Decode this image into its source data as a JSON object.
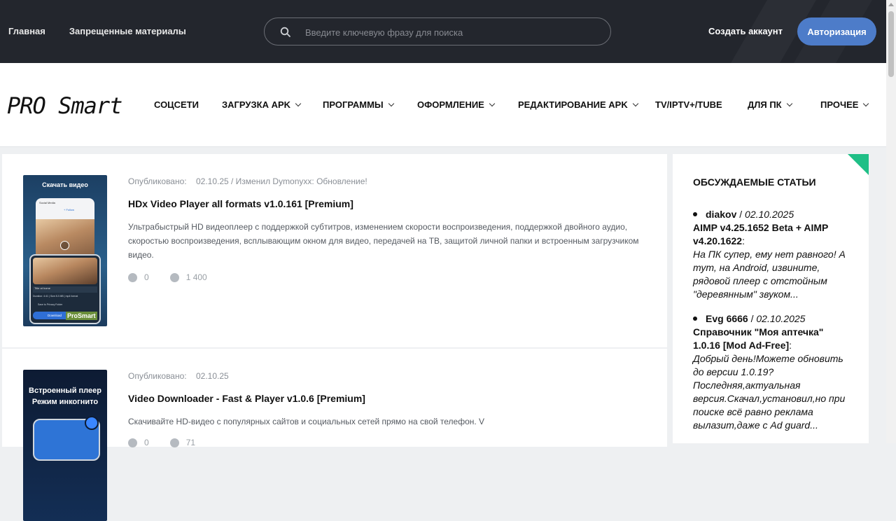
{
  "topbar": {
    "links": [
      "Главная",
      "Запрещенные материалы"
    ],
    "search_placeholder": "Введите ключевую фразу для поиска",
    "create_account": "Создать аккаунт",
    "login": "Авторизация",
    "colors": {
      "bg": "#23262d",
      "accent": "#4d7cc9"
    }
  },
  "header": {
    "logo": "PRO Smart",
    "nav": [
      {
        "label": "СОЦСЕТИ",
        "dropdown": false
      },
      {
        "label": "ЗАГРУЗКА APK",
        "dropdown": true
      },
      {
        "label": "ПРОГРАММЫ",
        "dropdown": true
      },
      {
        "label": "ОФОРМЛЕНИЕ",
        "dropdown": true
      },
      {
        "label": "РЕДАКТИРОВАНИЕ APK",
        "dropdown": true
      },
      {
        "label": "TV/IPTV+/TUBE",
        "dropdown": false
      },
      {
        "label": "ДЛЯ ПК",
        "dropdown": true
      },
      {
        "label": "ПРОЧЕЕ",
        "dropdown": true
      }
    ]
  },
  "posts": [
    {
      "meta_label": "Опубликовано:",
      "meta_value": "02.10.25 / Изменил Dymonyxx: Обновление!",
      "title": "HDx Video Player all formats v1.0.161 [Premium]",
      "description": "Ультрабыстрый HD видеоплеер с поддержкой субтитров, изменением скорости воспроизведения, поддержкой двойного аудио, скоростью воспроизведения, всплывающим окном для видео, передачей на ТВ, защитой личной папки и встроенным загрузчиком видео.",
      "comments": "0",
      "views": "1 400",
      "thumb": {
        "caption": "Скачать видео",
        "social": "Social Media",
        "follow": "+ Follow",
        "file": "Title at home",
        "info": "Duration: 4:41 | Size 8.3 MB | mp4 format",
        "save": "Save to Privacy Folder",
        "download": "Download",
        "watermark": "ProSmart"
      }
    },
    {
      "meta_label": "Опубликовано:",
      "meta_value": "02.10.25",
      "title": "Video Downloader - Fast & Player v1.0.6 [Premium]",
      "description": "Скачивайте HD-видео с популярных сайтов и социальных сетей прямо на свой телефон. V",
      "comments": "0",
      "views": "71",
      "thumb": {
        "caption_line1": "Встроенный плеер",
        "caption_line2": "Режим инкогнито"
      }
    }
  ],
  "sidebar": {
    "title": "ОБСУЖДАЕМЫЕ СТАТЬИ",
    "comments": [
      {
        "author": "diakov",
        "date": "02.10.2025",
        "article": "AIMP v4.25.1652 Beta + AIMP v4.20.1622",
        "text": "На ПК супер, ему нет равного! А тут, на Android, извините, рядовой плеер с отстойным \"деревянным\" звуком..."
      },
      {
        "author": "Evg 6666",
        "date": "02.10.2025",
        "article": "Справочник \"Моя аптечка\" 1.0.16 [Mod Ad-Free]",
        "text": "Добрый день!Можете обновить до версии 1.0.19? Последняя,актуальная версия.Скачал,установил,но при поиске всё равно реклама вылазит,даже с Ad guard..."
      }
    ]
  }
}
